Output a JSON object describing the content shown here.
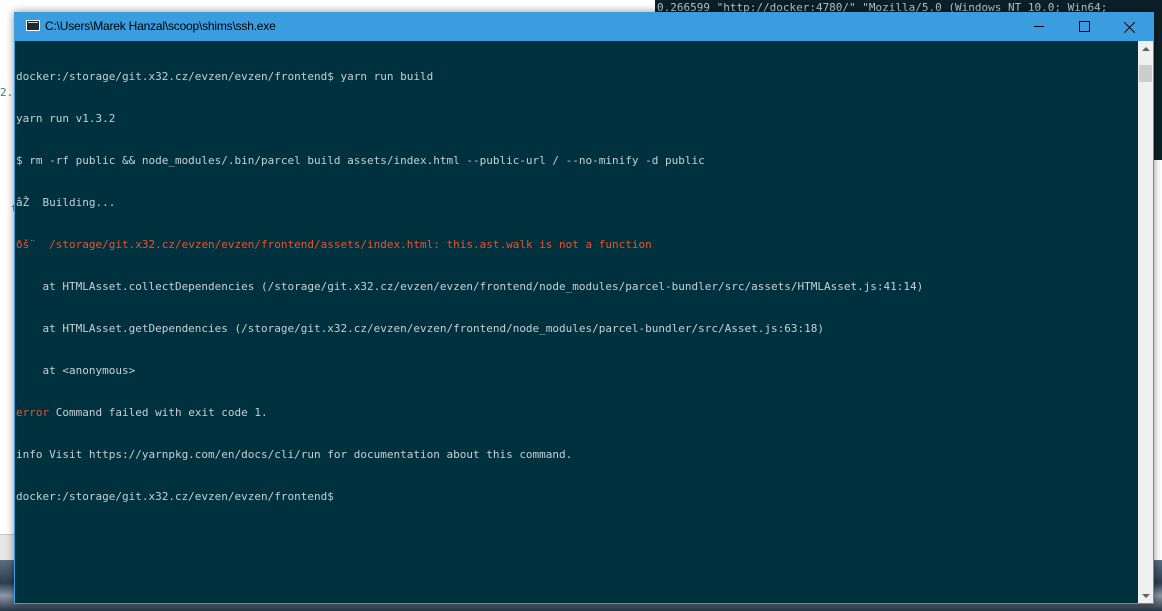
{
  "background_window": {
    "visible_line": "0.266599 \"http://docker:4780/\" \"Mozilla/5.0 (Windows NT 10.0; Win64;",
    "left_fragment_1": "2.:",
    "left_fragment_2": "t"
  },
  "window": {
    "title": "C:\\Users\\Marek Hanzal\\scoop\\shims\\ssh.exe",
    "icon": "console-window-icon",
    "controls": {
      "minimize_icon": "minimize-icon",
      "maximize_icon": "maximize-icon",
      "close_icon": "close-icon"
    }
  },
  "colors": {
    "titlebar": "#3a9de0",
    "terminal_background": "#00313f",
    "terminal_text": "#c7d0d3",
    "error_text": "#e8542e"
  },
  "terminal": {
    "lines": [
      {
        "text": "docker:/storage/git.x32.cz/evzen/evzen/frontend$ yarn run build"
      },
      {
        "text": "yarn run v1.3.2"
      },
      {
        "text": "$ rm -rf public && node_modules/.bin/parcel build assets/index.html --public-url / --no-minify -d public"
      },
      {
        "text": "âŽ  Building..."
      },
      {
        "prefix": "ðš¨",
        "rest": "  /storage/git.x32.cz/evzen/evzen/frontend/assets/index.html: this.ast.walk is not a function"
      },
      {
        "text": "    at HTMLAsset.collectDependencies (/storage/git.x32.cz/evzen/evzen/frontend/node_modules/parcel-bundler/src/assets/HTMLAsset.js:41:14)"
      },
      {
        "text": "    at HTMLAsset.getDependencies (/storage/git.x32.cz/evzen/evzen/frontend/node_modules/parcel-bundler/src/Asset.js:63:18)"
      },
      {
        "text": "    at <anonymous>"
      },
      {
        "prefix": "error",
        "rest": " Command failed with exit code 1."
      },
      {
        "text": "info Visit https://yarnpkg.com/en/docs/cli/run for documentation about this command."
      },
      {
        "text": "docker:/storage/git.x32.cz/evzen/evzen/frontend$ "
      }
    ]
  },
  "scrollbar": {
    "up_icon": "scroll-up-arrow-icon",
    "down_icon": "scroll-down-arrow-icon"
  }
}
